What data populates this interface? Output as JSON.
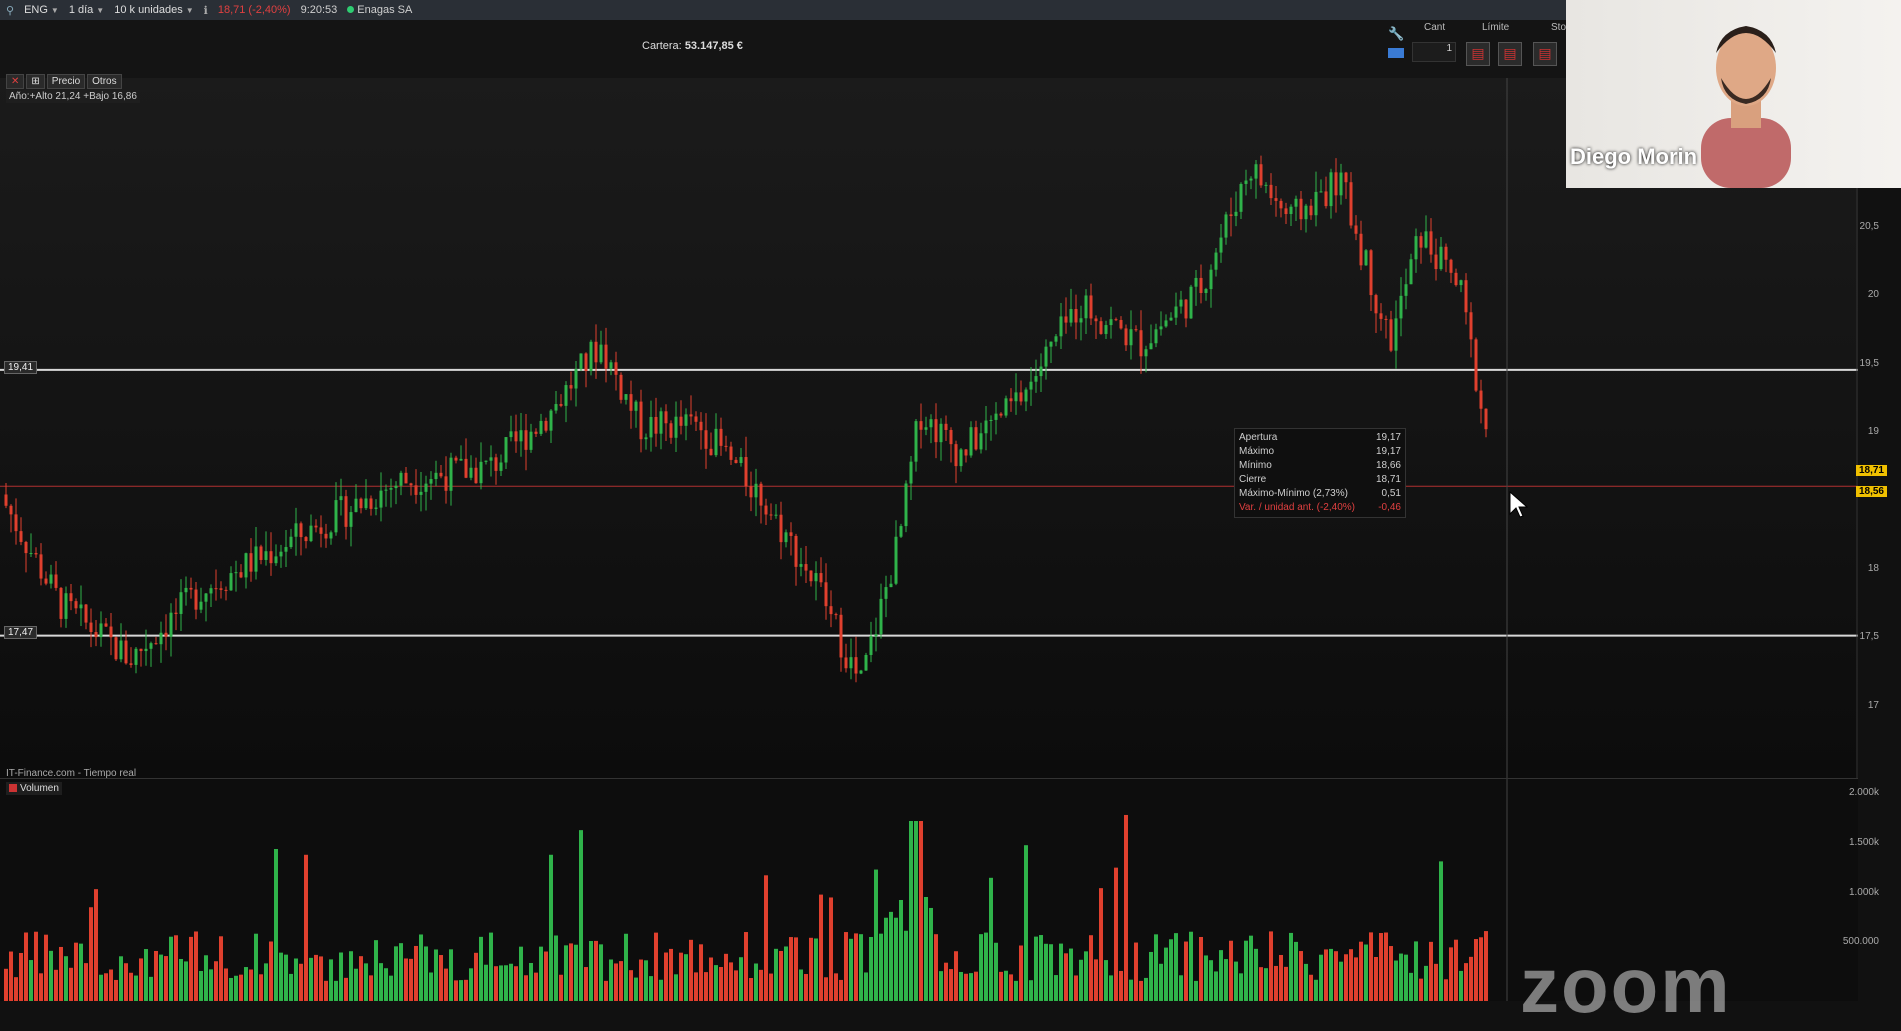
{
  "topbar": {
    "ticker": "ENG",
    "interval": "1 día",
    "units": "10 k unidades",
    "price_change": "18,71 (-2,40%)",
    "time": "9:20:53",
    "company": "Enagas SA"
  },
  "portfolio": {
    "label": "Cartera:",
    "value": "53.147,85 €"
  },
  "order_panel": {
    "qty_label": "Cant",
    "limit_label": "Límite",
    "stop_label": "Sto",
    "qty_value": "1"
  },
  "tabs": [
    "Precio",
    "Otros"
  ],
  "year_info": "Año:+Alto 21,24 +Bajo 16,86",
  "levels": {
    "upper": "19,41",
    "lower": "17,47"
  },
  "price_tags": {
    "last": "18,71",
    "current": "18,56"
  },
  "source": "IT-Finance.com - Tiempo real",
  "volume_label": "Volumen",
  "y_axis": [
    "20,5",
    "20",
    "19,5",
    "19",
    "18",
    "17,5",
    "17"
  ],
  "vol_axis": [
    "2.000k",
    "1.500k",
    "1.000k",
    "500.000"
  ],
  "tooltip": {
    "rows": [
      {
        "label": "Apertura",
        "value": "19,17"
      },
      {
        "label": "Máximo",
        "value": "19,17"
      },
      {
        "label": "Mínimo",
        "value": "18,66"
      },
      {
        "label": "Cierre",
        "value": "18,71"
      },
      {
        "label": "Máximo-Mínimo (2,73%)",
        "value": "0,51"
      },
      {
        "label": "Var. / unidad ant. (-2,40%)",
        "value": "-0,46"
      }
    ]
  },
  "webcam": {
    "name": "Diego Morin"
  },
  "watermark": "zoom",
  "colors": {
    "up": "#2fb34a",
    "down": "#e0402e",
    "accent": "#f0c000"
  }
}
